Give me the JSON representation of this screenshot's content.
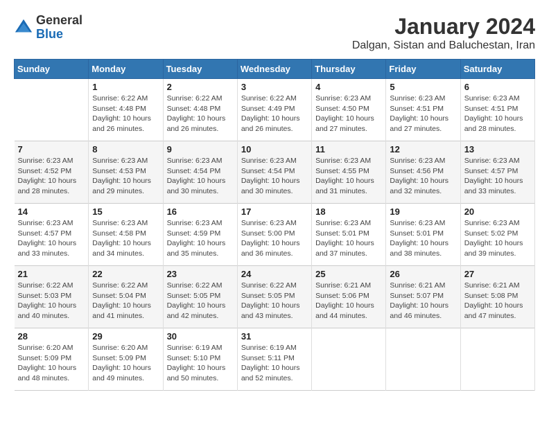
{
  "header": {
    "logo_general": "General",
    "logo_blue": "Blue",
    "month_year": "January 2024",
    "location": "Dalgan, Sistan and Baluchestan, Iran"
  },
  "calendar": {
    "days_of_week": [
      "Sunday",
      "Monday",
      "Tuesday",
      "Wednesday",
      "Thursday",
      "Friday",
      "Saturday"
    ],
    "weeks": [
      [
        {
          "day": "",
          "sunrise": "",
          "sunset": "",
          "daylight": ""
        },
        {
          "day": "1",
          "sunrise": "Sunrise: 6:22 AM",
          "sunset": "Sunset: 4:48 PM",
          "daylight": "Daylight: 10 hours and 26 minutes."
        },
        {
          "day": "2",
          "sunrise": "Sunrise: 6:22 AM",
          "sunset": "Sunset: 4:48 PM",
          "daylight": "Daylight: 10 hours and 26 minutes."
        },
        {
          "day": "3",
          "sunrise": "Sunrise: 6:22 AM",
          "sunset": "Sunset: 4:49 PM",
          "daylight": "Daylight: 10 hours and 26 minutes."
        },
        {
          "day": "4",
          "sunrise": "Sunrise: 6:23 AM",
          "sunset": "Sunset: 4:50 PM",
          "daylight": "Daylight: 10 hours and 27 minutes."
        },
        {
          "day": "5",
          "sunrise": "Sunrise: 6:23 AM",
          "sunset": "Sunset: 4:51 PM",
          "daylight": "Daylight: 10 hours and 27 minutes."
        },
        {
          "day": "6",
          "sunrise": "Sunrise: 6:23 AM",
          "sunset": "Sunset: 4:51 PM",
          "daylight": "Daylight: 10 hours and 28 minutes."
        }
      ],
      [
        {
          "day": "7",
          "sunrise": "Sunrise: 6:23 AM",
          "sunset": "Sunset: 4:52 PM",
          "daylight": "Daylight: 10 hours and 28 minutes."
        },
        {
          "day": "8",
          "sunrise": "Sunrise: 6:23 AM",
          "sunset": "Sunset: 4:53 PM",
          "daylight": "Daylight: 10 hours and 29 minutes."
        },
        {
          "day": "9",
          "sunrise": "Sunrise: 6:23 AM",
          "sunset": "Sunset: 4:54 PM",
          "daylight": "Daylight: 10 hours and 30 minutes."
        },
        {
          "day": "10",
          "sunrise": "Sunrise: 6:23 AM",
          "sunset": "Sunset: 4:54 PM",
          "daylight": "Daylight: 10 hours and 30 minutes."
        },
        {
          "day": "11",
          "sunrise": "Sunrise: 6:23 AM",
          "sunset": "Sunset: 4:55 PM",
          "daylight": "Daylight: 10 hours and 31 minutes."
        },
        {
          "day": "12",
          "sunrise": "Sunrise: 6:23 AM",
          "sunset": "Sunset: 4:56 PM",
          "daylight": "Daylight: 10 hours and 32 minutes."
        },
        {
          "day": "13",
          "sunrise": "Sunrise: 6:23 AM",
          "sunset": "Sunset: 4:57 PM",
          "daylight": "Daylight: 10 hours and 33 minutes."
        }
      ],
      [
        {
          "day": "14",
          "sunrise": "Sunrise: 6:23 AM",
          "sunset": "Sunset: 4:57 PM",
          "daylight": "Daylight: 10 hours and 33 minutes."
        },
        {
          "day": "15",
          "sunrise": "Sunrise: 6:23 AM",
          "sunset": "Sunset: 4:58 PM",
          "daylight": "Daylight: 10 hours and 34 minutes."
        },
        {
          "day": "16",
          "sunrise": "Sunrise: 6:23 AM",
          "sunset": "Sunset: 4:59 PM",
          "daylight": "Daylight: 10 hours and 35 minutes."
        },
        {
          "day": "17",
          "sunrise": "Sunrise: 6:23 AM",
          "sunset": "Sunset: 5:00 PM",
          "daylight": "Daylight: 10 hours and 36 minutes."
        },
        {
          "day": "18",
          "sunrise": "Sunrise: 6:23 AM",
          "sunset": "Sunset: 5:01 PM",
          "daylight": "Daylight: 10 hours and 37 minutes."
        },
        {
          "day": "19",
          "sunrise": "Sunrise: 6:23 AM",
          "sunset": "Sunset: 5:01 PM",
          "daylight": "Daylight: 10 hours and 38 minutes."
        },
        {
          "day": "20",
          "sunrise": "Sunrise: 6:23 AM",
          "sunset": "Sunset: 5:02 PM",
          "daylight": "Daylight: 10 hours and 39 minutes."
        }
      ],
      [
        {
          "day": "21",
          "sunrise": "Sunrise: 6:22 AM",
          "sunset": "Sunset: 5:03 PM",
          "daylight": "Daylight: 10 hours and 40 minutes."
        },
        {
          "day": "22",
          "sunrise": "Sunrise: 6:22 AM",
          "sunset": "Sunset: 5:04 PM",
          "daylight": "Daylight: 10 hours and 41 minutes."
        },
        {
          "day": "23",
          "sunrise": "Sunrise: 6:22 AM",
          "sunset": "Sunset: 5:05 PM",
          "daylight": "Daylight: 10 hours and 42 minutes."
        },
        {
          "day": "24",
          "sunrise": "Sunrise: 6:22 AM",
          "sunset": "Sunset: 5:05 PM",
          "daylight": "Daylight: 10 hours and 43 minutes."
        },
        {
          "day": "25",
          "sunrise": "Sunrise: 6:21 AM",
          "sunset": "Sunset: 5:06 PM",
          "daylight": "Daylight: 10 hours and 44 minutes."
        },
        {
          "day": "26",
          "sunrise": "Sunrise: 6:21 AM",
          "sunset": "Sunset: 5:07 PM",
          "daylight": "Daylight: 10 hours and 46 minutes."
        },
        {
          "day": "27",
          "sunrise": "Sunrise: 6:21 AM",
          "sunset": "Sunset: 5:08 PM",
          "daylight": "Daylight: 10 hours and 47 minutes."
        }
      ],
      [
        {
          "day": "28",
          "sunrise": "Sunrise: 6:20 AM",
          "sunset": "Sunset: 5:09 PM",
          "daylight": "Daylight: 10 hours and 48 minutes."
        },
        {
          "day": "29",
          "sunrise": "Sunrise: 6:20 AM",
          "sunset": "Sunset: 5:09 PM",
          "daylight": "Daylight: 10 hours and 49 minutes."
        },
        {
          "day": "30",
          "sunrise": "Sunrise: 6:19 AM",
          "sunset": "Sunset: 5:10 PM",
          "daylight": "Daylight: 10 hours and 50 minutes."
        },
        {
          "day": "31",
          "sunrise": "Sunrise: 6:19 AM",
          "sunset": "Sunset: 5:11 PM",
          "daylight": "Daylight: 10 hours and 52 minutes."
        },
        {
          "day": "",
          "sunrise": "",
          "sunset": "",
          "daylight": ""
        },
        {
          "day": "",
          "sunrise": "",
          "sunset": "",
          "daylight": ""
        },
        {
          "day": "",
          "sunrise": "",
          "sunset": "",
          "daylight": ""
        }
      ]
    ]
  }
}
